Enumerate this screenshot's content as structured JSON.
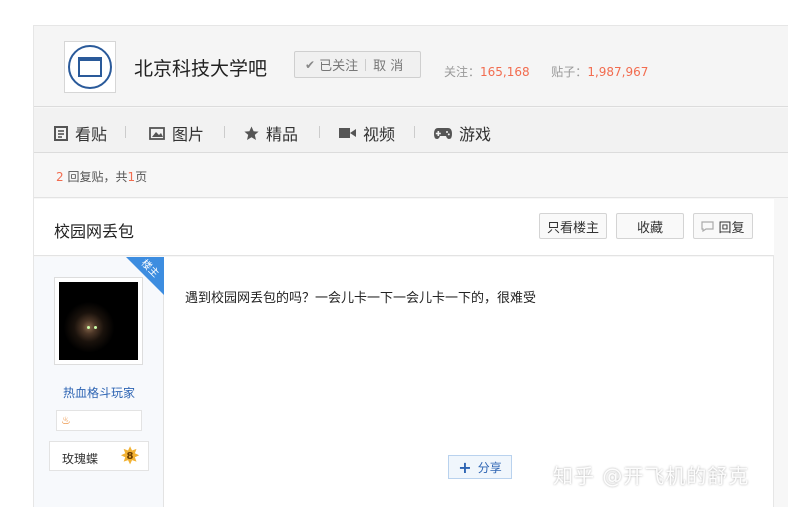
{
  "header": {
    "forum_name": "北京科技大学吧",
    "follow_button": {
      "followed_label": "已关注",
      "cancel_label": "取 消"
    },
    "stats": {
      "follow_label": "关注：",
      "follow_count": "165,168",
      "post_label": "贴子：",
      "post_count": "1,987,967"
    }
  },
  "nav": {
    "items": [
      {
        "label": "看贴",
        "icon": "document-icon"
      },
      {
        "label": "图片",
        "icon": "image-icon"
      },
      {
        "label": "精品",
        "icon": "star-icon"
      },
      {
        "label": "视频",
        "icon": "video-icon"
      },
      {
        "label": "游戏",
        "icon": "gamepad-icon"
      }
    ]
  },
  "reply_bar": {
    "reply_count": "2",
    "reply_text": "回复贴，共",
    "page_count": "1",
    "page_text": "页"
  },
  "post": {
    "title": "校园网丢包",
    "buttons": {
      "only_op": "只看楼主",
      "favorite": "收藏",
      "reply": "回复"
    },
    "author": {
      "username": "热血格斗玩家",
      "title": "玫瑰蝶",
      "level": "8",
      "corner_tag": "楼主"
    },
    "content": "遇到校园网丢包的吗？一会儿卡一下一会儿卡一下的，很难受",
    "share_label": "分享"
  },
  "watermark": "知乎 @开飞机的舒克",
  "colors": {
    "accent": "#f26c4f",
    "link": "#2d64b3",
    "corner": "#3d8de0"
  }
}
